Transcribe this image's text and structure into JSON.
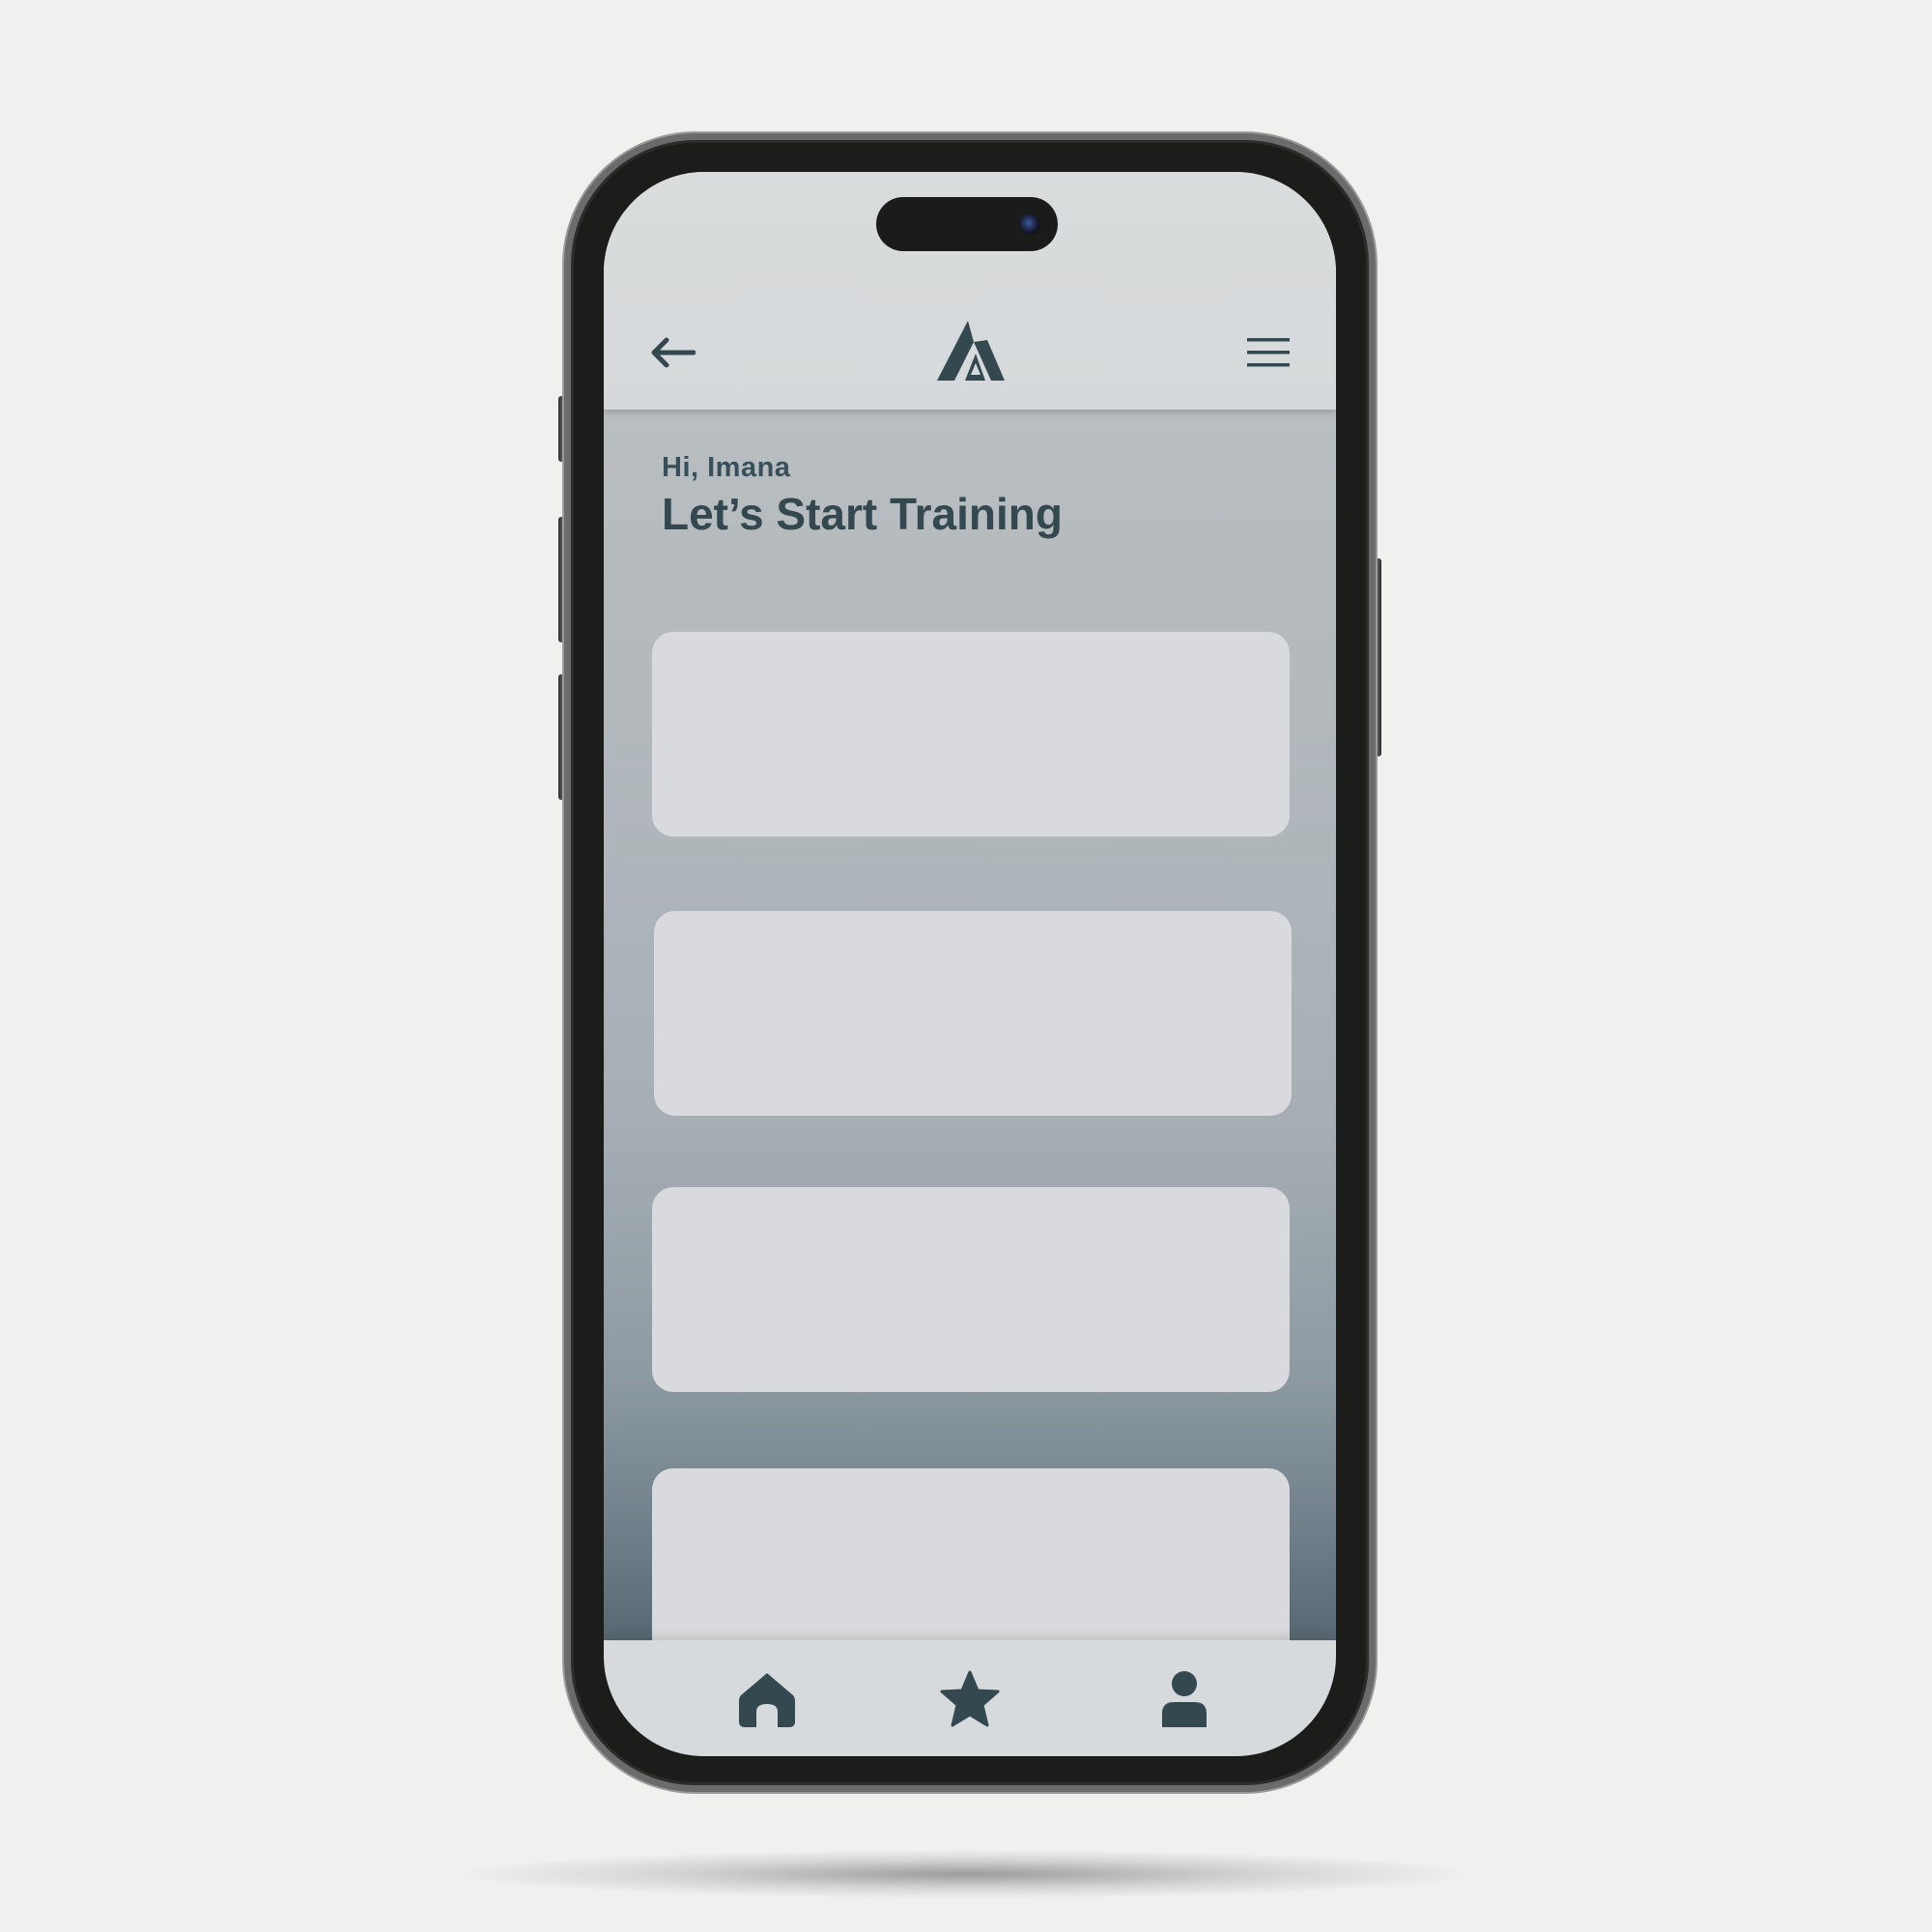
{
  "header": {
    "back_icon": "arrow-left-icon",
    "logo_icon": "mountain-logo-icon",
    "menu_icon": "hamburger-menu-icon"
  },
  "main": {
    "greeting": "Hi, Imana",
    "title": "Let’s Start Training",
    "cards": [
      {
        "label": ""
      },
      {
        "label": ""
      },
      {
        "label": ""
      },
      {
        "label": ""
      }
    ]
  },
  "bottom_nav": {
    "items": [
      {
        "icon": "home-icon"
      },
      {
        "icon": "star-icon"
      },
      {
        "icon": "user-icon"
      }
    ]
  },
  "colors": {
    "accent": "#33494f",
    "card": "#d8dadd",
    "bar": "#d6d9db",
    "background": "#f0f0ee"
  }
}
